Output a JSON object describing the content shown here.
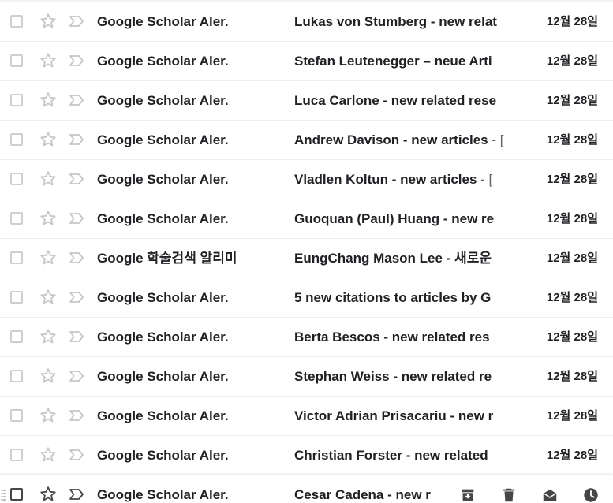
{
  "emails": [
    {
      "sender": "Google Scholar Aler.",
      "subject": "Lukas von Stumberg - new relat",
      "snippet": "",
      "date": "12월 28일"
    },
    {
      "sender": "Google Scholar Aler.",
      "subject": "Stefan Leutenegger – neue Arti",
      "snippet": "",
      "date": "12월 28일"
    },
    {
      "sender": "Google Scholar Aler.",
      "subject": "Luca Carlone - new related rese",
      "snippet": "",
      "date": "12월 28일"
    },
    {
      "sender": "Google Scholar Aler.",
      "subject": "Andrew Davison - new articles",
      "snippet": " - [",
      "date": "12월 28일"
    },
    {
      "sender": "Google Scholar Aler.",
      "subject": "Vladlen Koltun - new articles",
      "snippet": " - [",
      "date": "12월 28일"
    },
    {
      "sender": "Google Scholar Aler.",
      "subject": "Guoquan (Paul) Huang - new re",
      "snippet": "",
      "date": "12월 28일"
    },
    {
      "sender": "Google 학술검색 알리미",
      "subject": "EungChang Mason Lee - 새로운",
      "snippet": "",
      "date": "12월 28일"
    },
    {
      "sender": "Google Scholar Aler.",
      "subject": "5 new citations to articles by G",
      "snippet": "",
      "date": "12월 28일"
    },
    {
      "sender": "Google Scholar Aler.",
      "subject": "Berta Bescos - new related res",
      "snippet": "",
      "date": "12월 28일"
    },
    {
      "sender": "Google Scholar Aler.",
      "subject": "Stephan Weiss - new related re",
      "snippet": "",
      "date": "12월 28일"
    },
    {
      "sender": "Google Scholar Aler.",
      "subject": "Victor Adrian Prisacariu - new r",
      "snippet": "",
      "date": "12월 28일"
    },
    {
      "sender": "Google Scholar Aler.",
      "subject": "Christian Forster - new related",
      "snippet": "",
      "date": "12월 28일"
    },
    {
      "sender": "Google Scholar Aler.",
      "subject": "Cesar Cadena - new r",
      "snippet": "",
      "date": "",
      "hovered": true
    }
  ],
  "hover_actions": [
    {
      "name": "archive-button",
      "icon": "archive-icon"
    },
    {
      "name": "delete-button",
      "icon": "trash-icon"
    },
    {
      "name": "mark-as-read-button",
      "icon": "open-envelope-icon"
    },
    {
      "name": "snooze-button",
      "icon": "clock-icon"
    }
  ],
  "colors": {
    "text": "#202124",
    "snippet": "#5f6368",
    "icon": "#c4c7c5",
    "icon_dark": "#444746",
    "divider": "#eeeeee"
  }
}
